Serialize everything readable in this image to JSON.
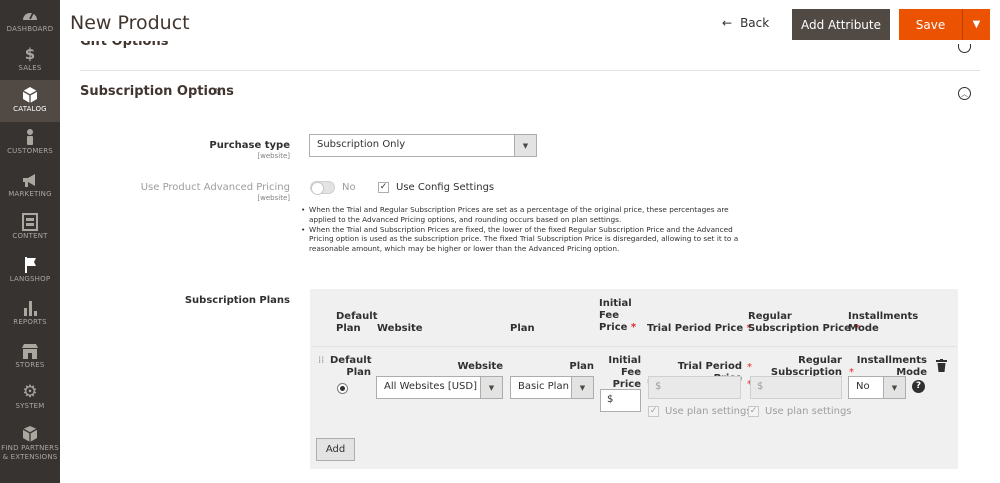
{
  "sidebar": {
    "items": [
      {
        "label": "DASHBOARD",
        "icon": "dashboard-icon"
      },
      {
        "label": "SALES",
        "icon": "dollar-icon"
      },
      {
        "label": "CATALOG",
        "icon": "cube-icon",
        "active": true
      },
      {
        "label": "CUSTOMERS",
        "icon": "person-icon"
      },
      {
        "label": "MARKETING",
        "icon": "megaphone-icon"
      },
      {
        "label": "CONTENT",
        "icon": "layout-icon"
      },
      {
        "label": "LANGSHOP",
        "icon": "flag-icon"
      },
      {
        "label": "REPORTS",
        "icon": "bar-chart-icon"
      },
      {
        "label": "STORES",
        "icon": "storefront-icon"
      },
      {
        "label": "SYSTEM",
        "icon": "gear-icon"
      },
      {
        "label_line1": "FIND PARTNERS",
        "label_line2": "& EXTENSIONS",
        "icon": "box-icon"
      }
    ]
  },
  "header": {
    "title": "New Product",
    "back_label": "Back",
    "back_icon": "←",
    "add_attribute_label": "Add Attribute",
    "save_label": "Save"
  },
  "sections": {
    "gift_options_title": "Gift Options",
    "subscription_title": "Subscription Options"
  },
  "form": {
    "purchase_type_label": "Purchase type",
    "purchase_type_scope": "[website]",
    "purchase_type_value": "Subscription Only",
    "adv_pricing_label": "Use Product Advanced Pricing",
    "adv_pricing_scope": "[website]",
    "adv_pricing_toggle_text": "No",
    "use_config_label": "Use Config Settings",
    "notes": [
      "When the Trial and Regular Subscription Prices are set as a percentage of the original price, these percentages are applied to the Advanced Pricing options, and rounding occurs based on plan settings.",
      "When the Trial and Subscription Prices are fixed, the lower of the fixed Regular Subscription Price and the Advanced Pricing option is used as the subscription price. The fixed Trial Subscription Price is disregarded, allowing to set it to a reasonable amount, which may be higher or lower than the Advanced Pricing option."
    ],
    "plans_label": "Subscription Plans"
  },
  "plans_grid": {
    "headers": {
      "default_plan_1": "Default",
      "default_plan_2": "Plan",
      "website": "Website",
      "plan": "Plan",
      "initial_fee_1": "Initial",
      "initial_fee_2": "Fee",
      "initial_fee_3": "Price",
      "trial_price": "Trial Period Price",
      "regular_1": "Regular",
      "regular_2": "Subscription Price",
      "installments_1": "Installments",
      "installments_2": "Mode"
    },
    "row": {
      "default_plan_1": "Default",
      "default_plan_2": "Plan",
      "website_label": "Website",
      "website_value": "All Websites [USD]",
      "plan_label": "Plan",
      "plan_value": "Basic Plan",
      "initial_fee_1": "Initial",
      "initial_fee_2": "Fee",
      "initial_fee_3": "Price",
      "initial_fee_prefix": "$",
      "trial_label": "Trial Period Price",
      "trial_prefix": "$",
      "regular_1": "Regular",
      "regular_2": "Subscription Price",
      "regular_prefix": "$",
      "installments_1": "Installments",
      "installments_2": "Mode",
      "installments_value": "No",
      "use_plan_settings": "Use plan settings",
      "help_glyph": "?"
    },
    "add_label": "Add"
  },
  "colors": {
    "sidebar_bg": "#373330",
    "accent_orange": "#eb5202",
    "dark_button": "#514943",
    "required": "#e22626"
  }
}
